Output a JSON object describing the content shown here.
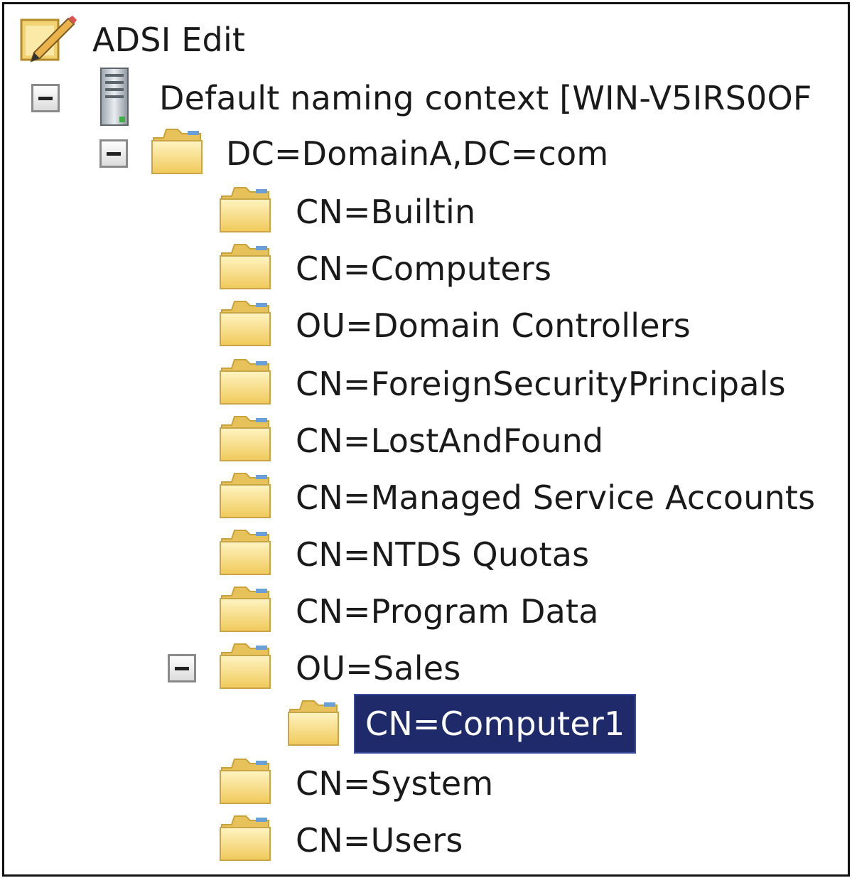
{
  "tree": {
    "root": {
      "label": "ADSI Edit",
      "icon": "adsi-edit-icon"
    },
    "context": {
      "label": "Default naming context [WIN-V5IRS0OF",
      "icon": "server-icon",
      "expanded": true
    },
    "domain": {
      "label": "DC=DomainA,DC=com",
      "icon": "folder-icon",
      "expanded": true
    },
    "children": [
      {
        "label": "CN=Builtin"
      },
      {
        "label": "CN=Computers"
      },
      {
        "label": "OU=Domain Controllers"
      },
      {
        "label": "CN=ForeignSecurityPrincipals"
      },
      {
        "label": "CN=LostAndFound"
      },
      {
        "label": "CN=Managed Service Accounts"
      },
      {
        "label": "CN=NTDS Quotas"
      },
      {
        "label": "CN=Program Data"
      },
      {
        "label": "OU=Sales",
        "expanded": true
      },
      {
        "label": "CN=System"
      },
      {
        "label": "CN=Users"
      }
    ],
    "sales_children": [
      {
        "label": "CN=Computer1",
        "selected": true
      }
    ]
  },
  "colors": {
    "selection_bg": "#1f2a6b",
    "selection_text": "#ffffff",
    "folder_fill": "#f5d77a"
  }
}
